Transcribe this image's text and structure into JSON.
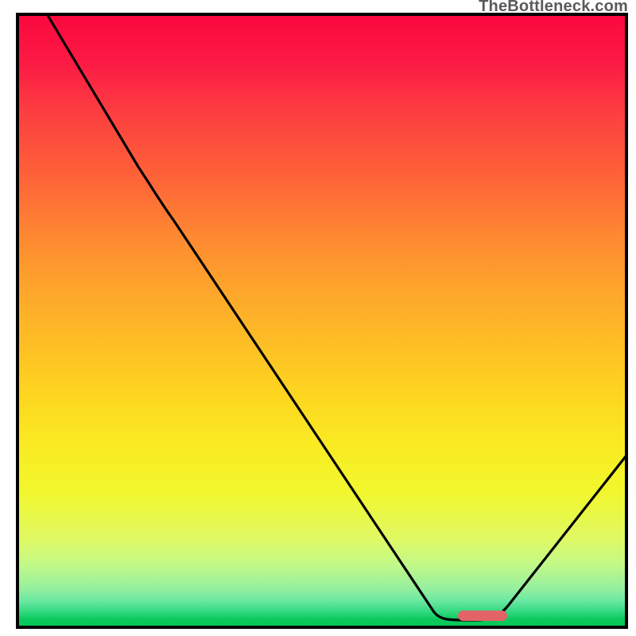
{
  "watermark": "TheBottleneck.com",
  "chart_data": {
    "type": "line",
    "title": "",
    "xlabel": "",
    "ylabel": "",
    "xlim": [
      0,
      100
    ],
    "ylim": [
      0,
      100
    ],
    "grid": false,
    "legend": false,
    "curve_points": [
      {
        "x": 4.5,
        "y": 100
      },
      {
        "x": 22,
        "y": 73
      },
      {
        "x": 69,
        "y": 2
      },
      {
        "x": 74,
        "y": 1
      },
      {
        "x": 80,
        "y": 2
      },
      {
        "x": 100,
        "y": 31
      }
    ],
    "marker": {
      "x_start": 72,
      "x_end": 80,
      "y": 1.7
    },
    "background_gradient": {
      "top": "#fb083f",
      "middle": "#fdd520",
      "bottom": "#07c859"
    },
    "curve_color": "#000000",
    "marker_color": "#e26468"
  }
}
